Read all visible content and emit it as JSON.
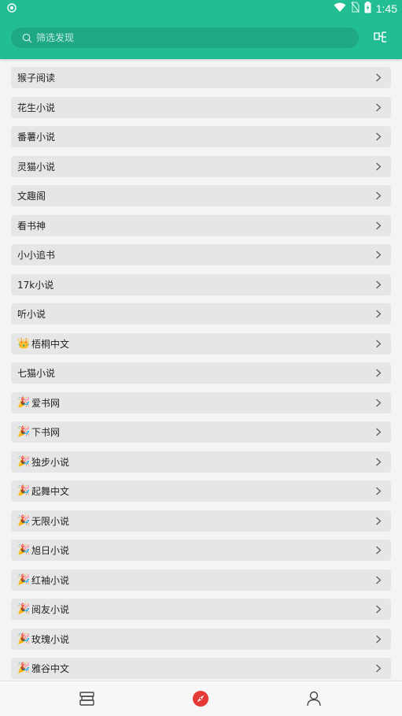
{
  "status": {
    "time": "1:45",
    "icons": [
      "vpn-icon",
      "wifi-icon",
      "no-sim-icon",
      "battery-charging-icon"
    ]
  },
  "header": {
    "search_placeholder": "筛选发现",
    "menu_icon": "grid-menu-icon",
    "accent_color": "#22bd93"
  },
  "items": [
    {
      "label": "猴子阅读",
      "emoji": ""
    },
    {
      "label": "花生小说",
      "emoji": ""
    },
    {
      "label": "番薯小说",
      "emoji": ""
    },
    {
      "label": "灵猫小说",
      "emoji": ""
    },
    {
      "label": "文趣阁",
      "emoji": ""
    },
    {
      "label": "看书神",
      "emoji": ""
    },
    {
      "label": "小小追书",
      "emoji": ""
    },
    {
      "label": "17k小说",
      "emoji": ""
    },
    {
      "label": "听小说",
      "emoji": ""
    },
    {
      "label": "梧桐中文",
      "emoji": "👑"
    },
    {
      "label": "七猫小说",
      "emoji": ""
    },
    {
      "label": "爱书网",
      "emoji": "🎉"
    },
    {
      "label": "下书网",
      "emoji": "🎉"
    },
    {
      "label": "独步小说",
      "emoji": "🎉"
    },
    {
      "label": "起舞中文",
      "emoji": "🎉"
    },
    {
      "label": "无限小说",
      "emoji": "🎉"
    },
    {
      "label": "旭日小说",
      "emoji": "🎉"
    },
    {
      "label": "红袖小说",
      "emoji": "🎉"
    },
    {
      "label": "阅友小说",
      "emoji": "🎉"
    },
    {
      "label": "玫瑰小说",
      "emoji": "🎉"
    },
    {
      "label": "雅谷中文",
      "emoji": "🎉"
    }
  ],
  "bottom_nav": [
    {
      "name": "bookshelf-icon",
      "active": false
    },
    {
      "name": "compass-discover-icon",
      "active": true,
      "color": "#e53935"
    },
    {
      "name": "profile-icon",
      "active": false
    }
  ]
}
